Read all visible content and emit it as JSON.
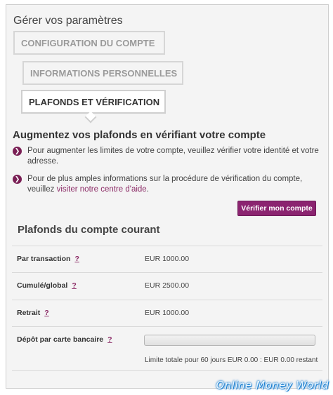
{
  "page": {
    "title": "Gérer vos paramètres",
    "steps": [
      {
        "label": "CONFIGURATION DU COMPTE"
      },
      {
        "label": "INFORMATIONS PERSONNELLES"
      },
      {
        "label": "PLAFONDS ET VÉRIFICATION"
      }
    ]
  },
  "intro": {
    "heading": "Augmentez vos plafonds en vérifiant votre compte",
    "bullet1": "Pour augmenter les limites de votre compte, veuillez vérifier votre identité et votre adresse.",
    "bullet2_prefix": "Pour de plus amples informations sur la procédure de vérification du compte, veuillez ",
    "bullet2_link": "visiter notre centre d'aide",
    "bullet2_suffix": ".",
    "bullet_icon": "chevron-right-icon",
    "verify_button": "Vérifier mon compte"
  },
  "limits": {
    "title": "Plafonds du compte courant",
    "help": "?",
    "rows": [
      {
        "label": "Par transaction",
        "value": "EUR 1000.00"
      },
      {
        "label": "Cumulé/global",
        "value": "EUR 2500.00"
      },
      {
        "label": "Retrait",
        "value": "EUR 1000.00"
      },
      {
        "label": "Dépôt par carte bancaire",
        "progress": 0.0
      }
    ],
    "card_note": "Limite totale pour 60 jours EUR 0.00 : EUR 0.00 restant"
  },
  "watermark": "Online Money World",
  "colors": {
    "accent": "#8b2470",
    "link": "#8b2b66",
    "watermark_glow": "#1a7fd1"
  }
}
